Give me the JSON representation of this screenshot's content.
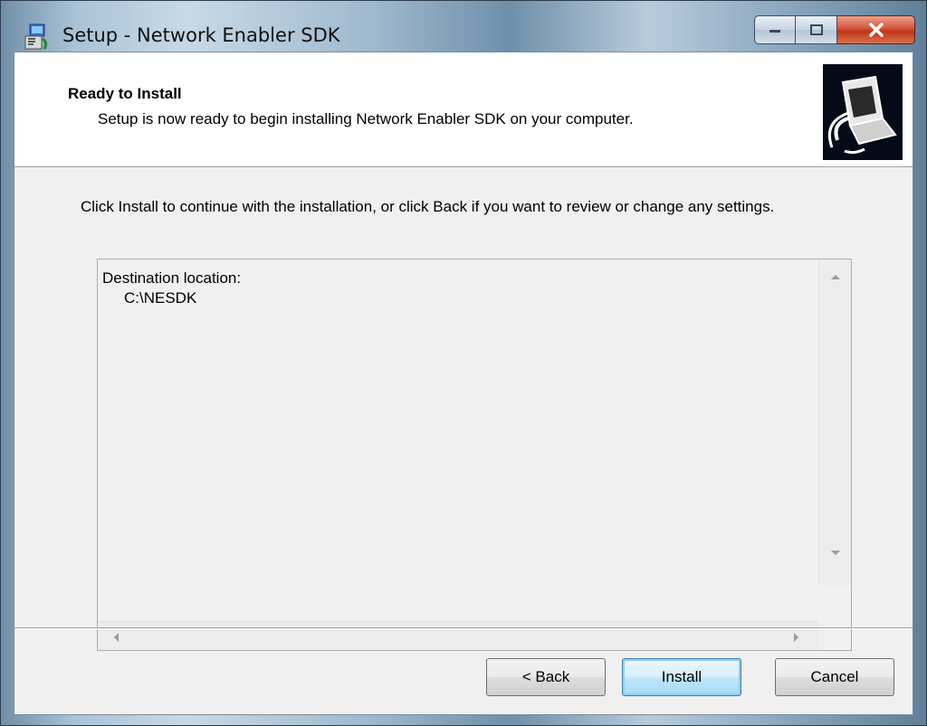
{
  "window": {
    "title": "Setup - Network Enabler SDK"
  },
  "header": {
    "title": "Ready to Install",
    "subtitle": "Setup is now ready to begin installing Network Enabler SDK on your computer."
  },
  "body": {
    "instructions": "Click Install to continue with the installation, or click Back if you want to review or change any settings."
  },
  "memo": {
    "line1": "Destination location:",
    "line2": "C:\\NESDK"
  },
  "buttons": {
    "back": "< Back",
    "install": "Install",
    "cancel": "Cancel"
  },
  "icons": {
    "app": "installer-icon",
    "wizard": "computer-install-icon",
    "minimize": "minimize-icon",
    "maximize": "maximize-icon",
    "close": "close-icon"
  },
  "colors": {
    "close_button": "#c7432a",
    "default_button_border": "#3c7fb1",
    "dialog_background": "#f0f0f0"
  }
}
